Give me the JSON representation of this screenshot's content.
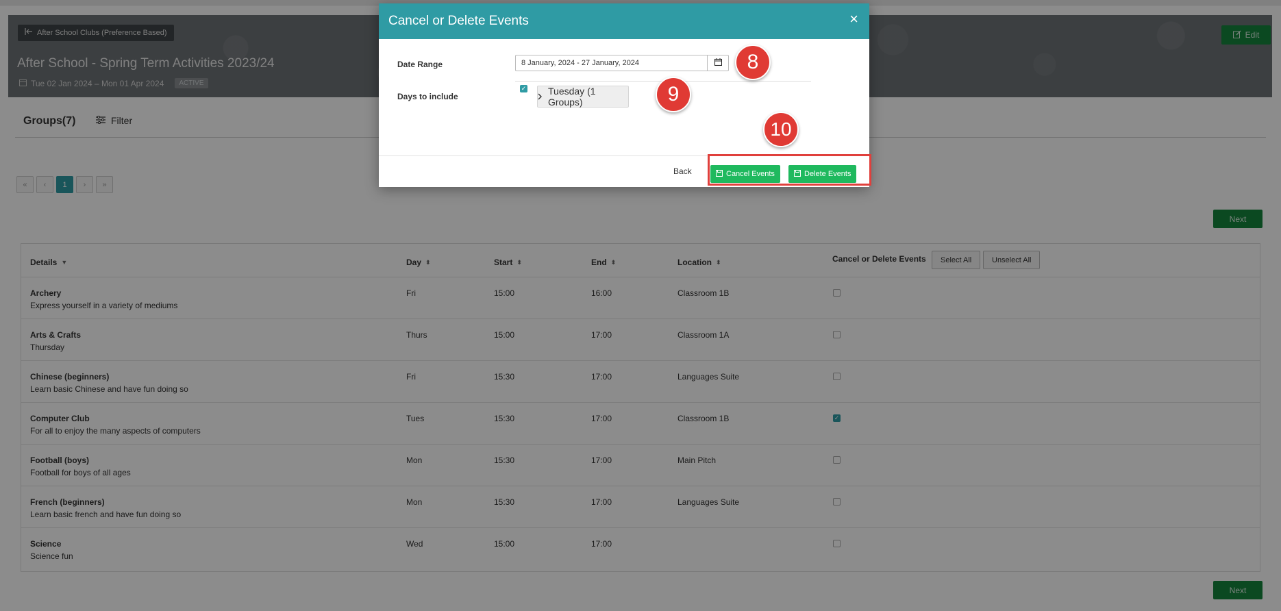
{
  "banner": {
    "back_label": "After School Clubs (Preference Based)",
    "title": "After School - Spring Term Activities 2023/24",
    "dates": "Tue 02 Jan 2024 – Mon 01 Apr 2024",
    "status": "ACTIVE",
    "edit_label": "Edit"
  },
  "groups": {
    "title": "Groups(7)",
    "filter_label": "Filter"
  },
  "pager": {
    "first": "«",
    "prev": "‹",
    "current": "1",
    "next": "›",
    "last": "»"
  },
  "next_label": "Next",
  "table": {
    "headers": {
      "details": "Details",
      "day": "Day",
      "start": "Start",
      "end": "End",
      "location": "Location",
      "cancel_delete": "Cancel or Delete Events",
      "select_all": "Select All",
      "unselect_all": "Unselect All"
    },
    "rows": [
      {
        "name": "Archery",
        "desc": "Express yourself in a variety of mediums",
        "day": "Fri",
        "start": "15:00",
        "end": "16:00",
        "location": "Classroom 1B",
        "checked": false
      },
      {
        "name": "Arts & Crafts",
        "desc": "Thursday",
        "day": "Thurs",
        "start": "15:00",
        "end": "17:00",
        "location": "Classroom 1A",
        "checked": false
      },
      {
        "name": "Chinese (beginners)",
        "desc": "Learn basic Chinese and have fun doing so",
        "day": "Fri",
        "start": "15:30",
        "end": "17:00",
        "location": "Languages Suite",
        "checked": false
      },
      {
        "name": "Computer Club",
        "desc": "For all to enjoy the many aspects of computers",
        "day": "Tues",
        "start": "15:30",
        "end": "17:00",
        "location": "Classroom 1B",
        "checked": true
      },
      {
        "name": "Football (boys)",
        "desc": "Football for boys of all ages",
        "day": "Mon",
        "start": "15:30",
        "end": "17:00",
        "location": "Main Pitch",
        "checked": false
      },
      {
        "name": "French (beginners)",
        "desc": "Learn basic french and have fun doing so",
        "day": "Mon",
        "start": "15:30",
        "end": "17:00",
        "location": "Languages Suite",
        "checked": false
      },
      {
        "name": "Science",
        "desc": "Science fun",
        "day": "Wed",
        "start": "15:00",
        "end": "17:00",
        "location": "",
        "checked": false
      }
    ]
  },
  "modal": {
    "title": "Cancel or Delete Events",
    "close_glyph": "×",
    "date_range_label": "Date Range",
    "date_range_value": "8 January, 2024 - 27 January, 2024",
    "days_label": "Days to include",
    "day_group_label": "Tuesday (1 Groups)",
    "back_label": "Back",
    "cancel_events_label": "Cancel Events",
    "delete_events_label": "Delete Events"
  },
  "steps": {
    "s8": "8",
    "s9": "9",
    "s10": "10"
  },
  "colors": {
    "teal": "#2f9ba4",
    "green_action": "#1fb95e",
    "green_dark": "#14863d",
    "marker_red": "#e03a34"
  }
}
